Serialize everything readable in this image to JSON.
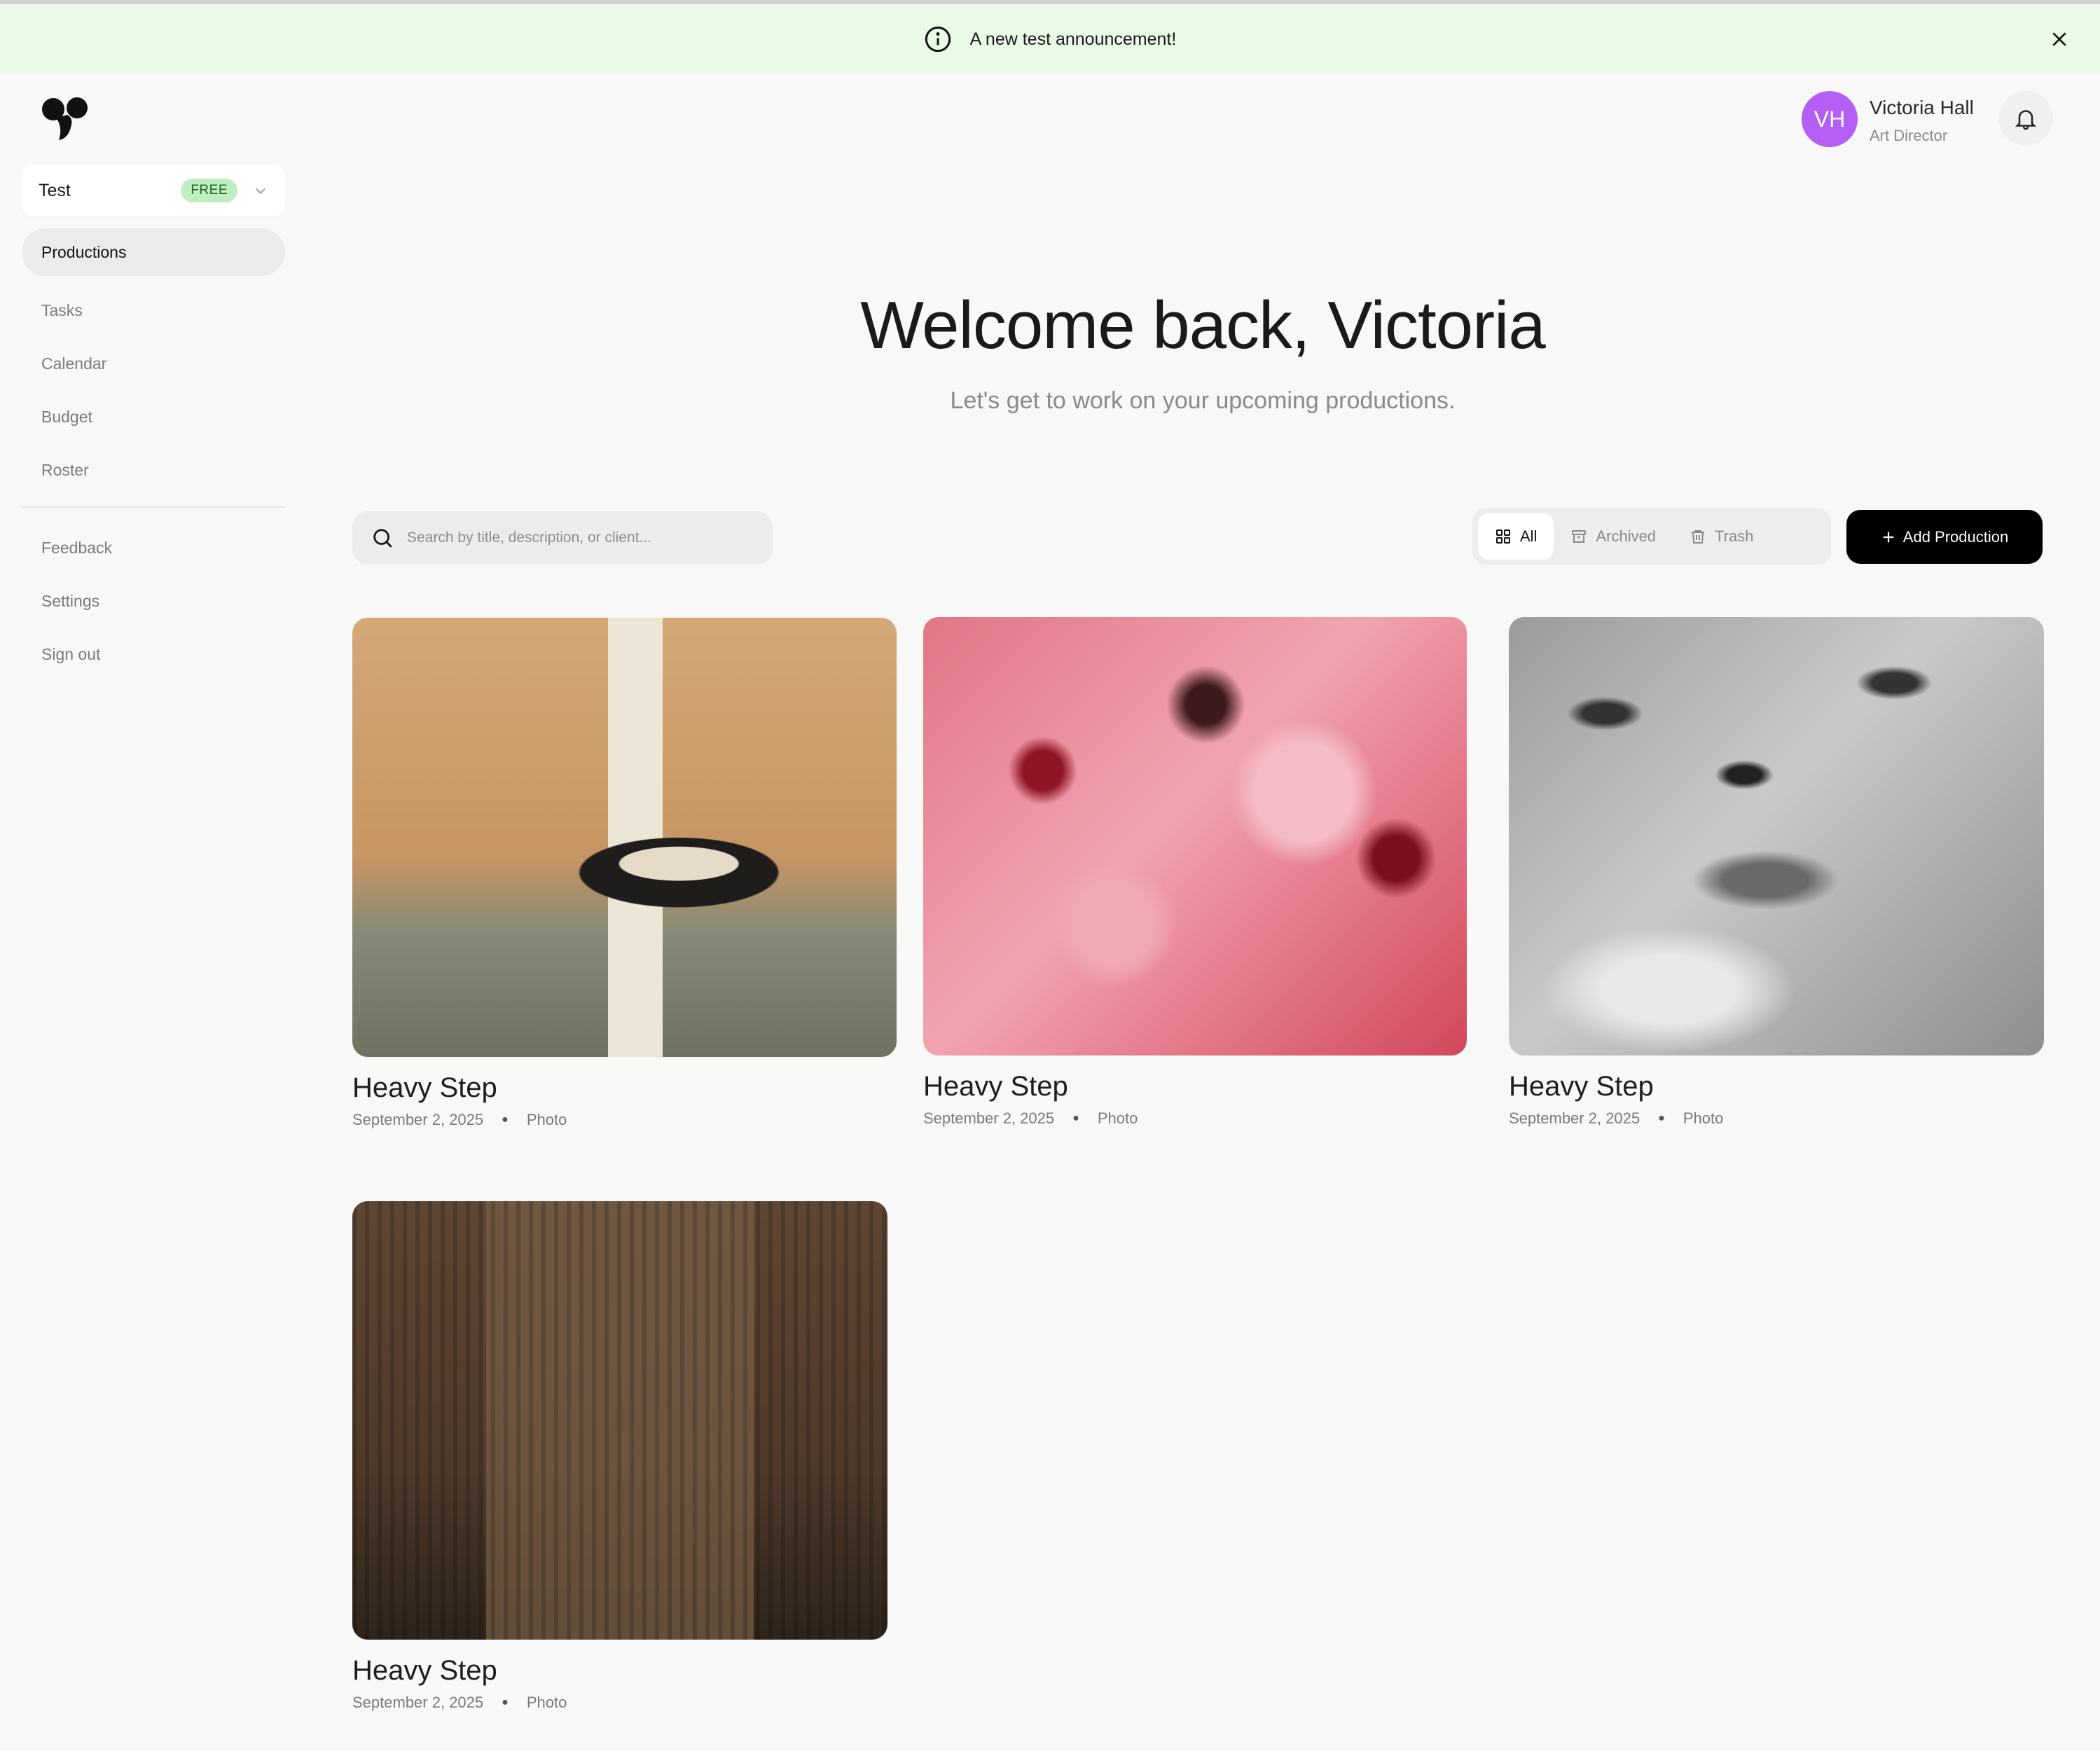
{
  "announcement": {
    "text": "A new test announcement!"
  },
  "workspace": {
    "name": "Test",
    "plan_badge": "FREE"
  },
  "sidebar": {
    "primary": [
      {
        "label": "Productions",
        "active": true
      },
      {
        "label": "Tasks"
      },
      {
        "label": "Calendar"
      },
      {
        "label": "Budget"
      },
      {
        "label": "Roster"
      }
    ],
    "secondary": [
      {
        "label": "Feedback"
      },
      {
        "label": "Settings"
      },
      {
        "label": "Sign out"
      }
    ]
  },
  "user": {
    "initials": "VH",
    "name": "Victoria Hall",
    "role": "Art Director",
    "avatar_color": "#b55ef3"
  },
  "hero": {
    "title": "Welcome back, Victoria",
    "subtitle": "Let's get to work on your upcoming productions."
  },
  "search": {
    "placeholder": "Search by title, description, or client..."
  },
  "filters": [
    {
      "label": "All",
      "icon": "grid-icon",
      "active": true
    },
    {
      "label": "Archived",
      "icon": "archive-icon"
    },
    {
      "label": "Trash",
      "icon": "trash-icon"
    }
  ],
  "add_button": {
    "label": "Add Production"
  },
  "productions": [
    {
      "title": "Heavy Step",
      "date": "September 2, 2025",
      "type": "Photo",
      "image": "interior-room"
    },
    {
      "title": "Heavy Step",
      "date": "September 2, 2025",
      "type": "Photo",
      "image": "pink-flowers"
    },
    {
      "title": "Heavy Step",
      "date": "September 2, 2025",
      "type": "Photo",
      "image": "portrait-face"
    },
    {
      "title": "Heavy Step",
      "date": "September 2, 2025",
      "type": "Photo",
      "image": "leather-bag"
    }
  ],
  "colors": {
    "announcement_bg": "#e9fbe7",
    "badge_bg": "#bfeec0",
    "primary_button": "#000000",
    "page_bg": "#f8f8f8"
  }
}
